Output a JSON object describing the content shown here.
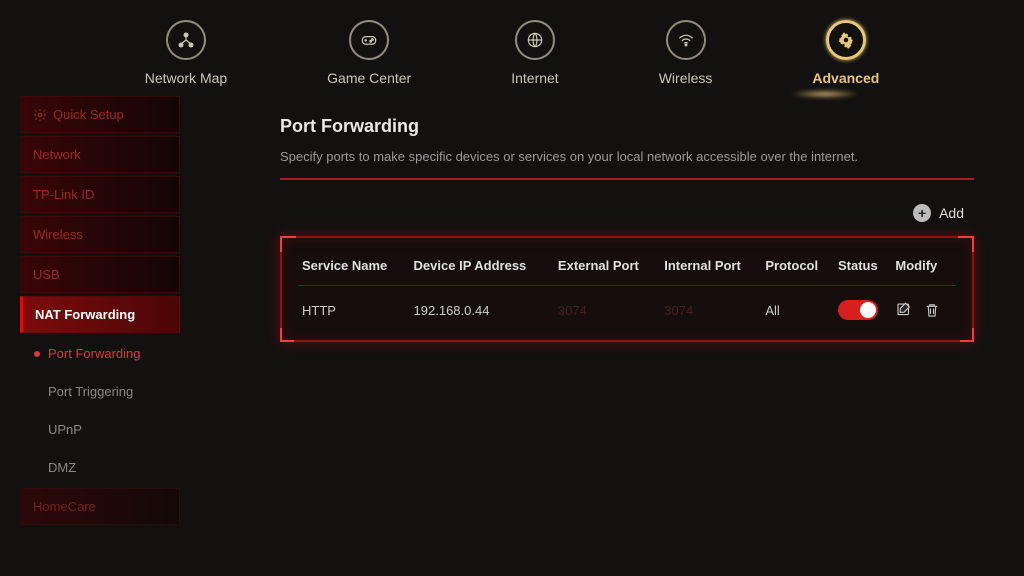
{
  "nav": {
    "items": [
      {
        "label": "Network Map"
      },
      {
        "label": "Game Center"
      },
      {
        "label": "Internet"
      },
      {
        "label": "Wireless"
      },
      {
        "label": "Advanced"
      }
    ]
  },
  "sidebar": {
    "quick_setup": "Quick Setup",
    "network": "Network",
    "tplink_id": "TP-Link ID",
    "wireless": "Wireless",
    "usb": "USB",
    "nat_forwarding": "NAT Forwarding",
    "port_forwarding": "Port Forwarding",
    "port_triggering": "Port Triggering",
    "upnp": "UPnP",
    "dmz": "DMZ",
    "homecare": "HomeCare"
  },
  "page": {
    "title": "Port Forwarding",
    "desc": "Specify ports to make specific devices or services on your local network accessible over the internet.",
    "add_label": "Add"
  },
  "table": {
    "headers": {
      "service": "Service Name",
      "ip": "Device IP Address",
      "ext": "External Port",
      "int": "Internal Port",
      "proto": "Protocol",
      "status": "Status",
      "modify": "Modify"
    },
    "row": {
      "service": "HTTP",
      "ip": "192.168.0.44",
      "ext": "3074",
      "int": "3074",
      "proto": "All"
    }
  }
}
